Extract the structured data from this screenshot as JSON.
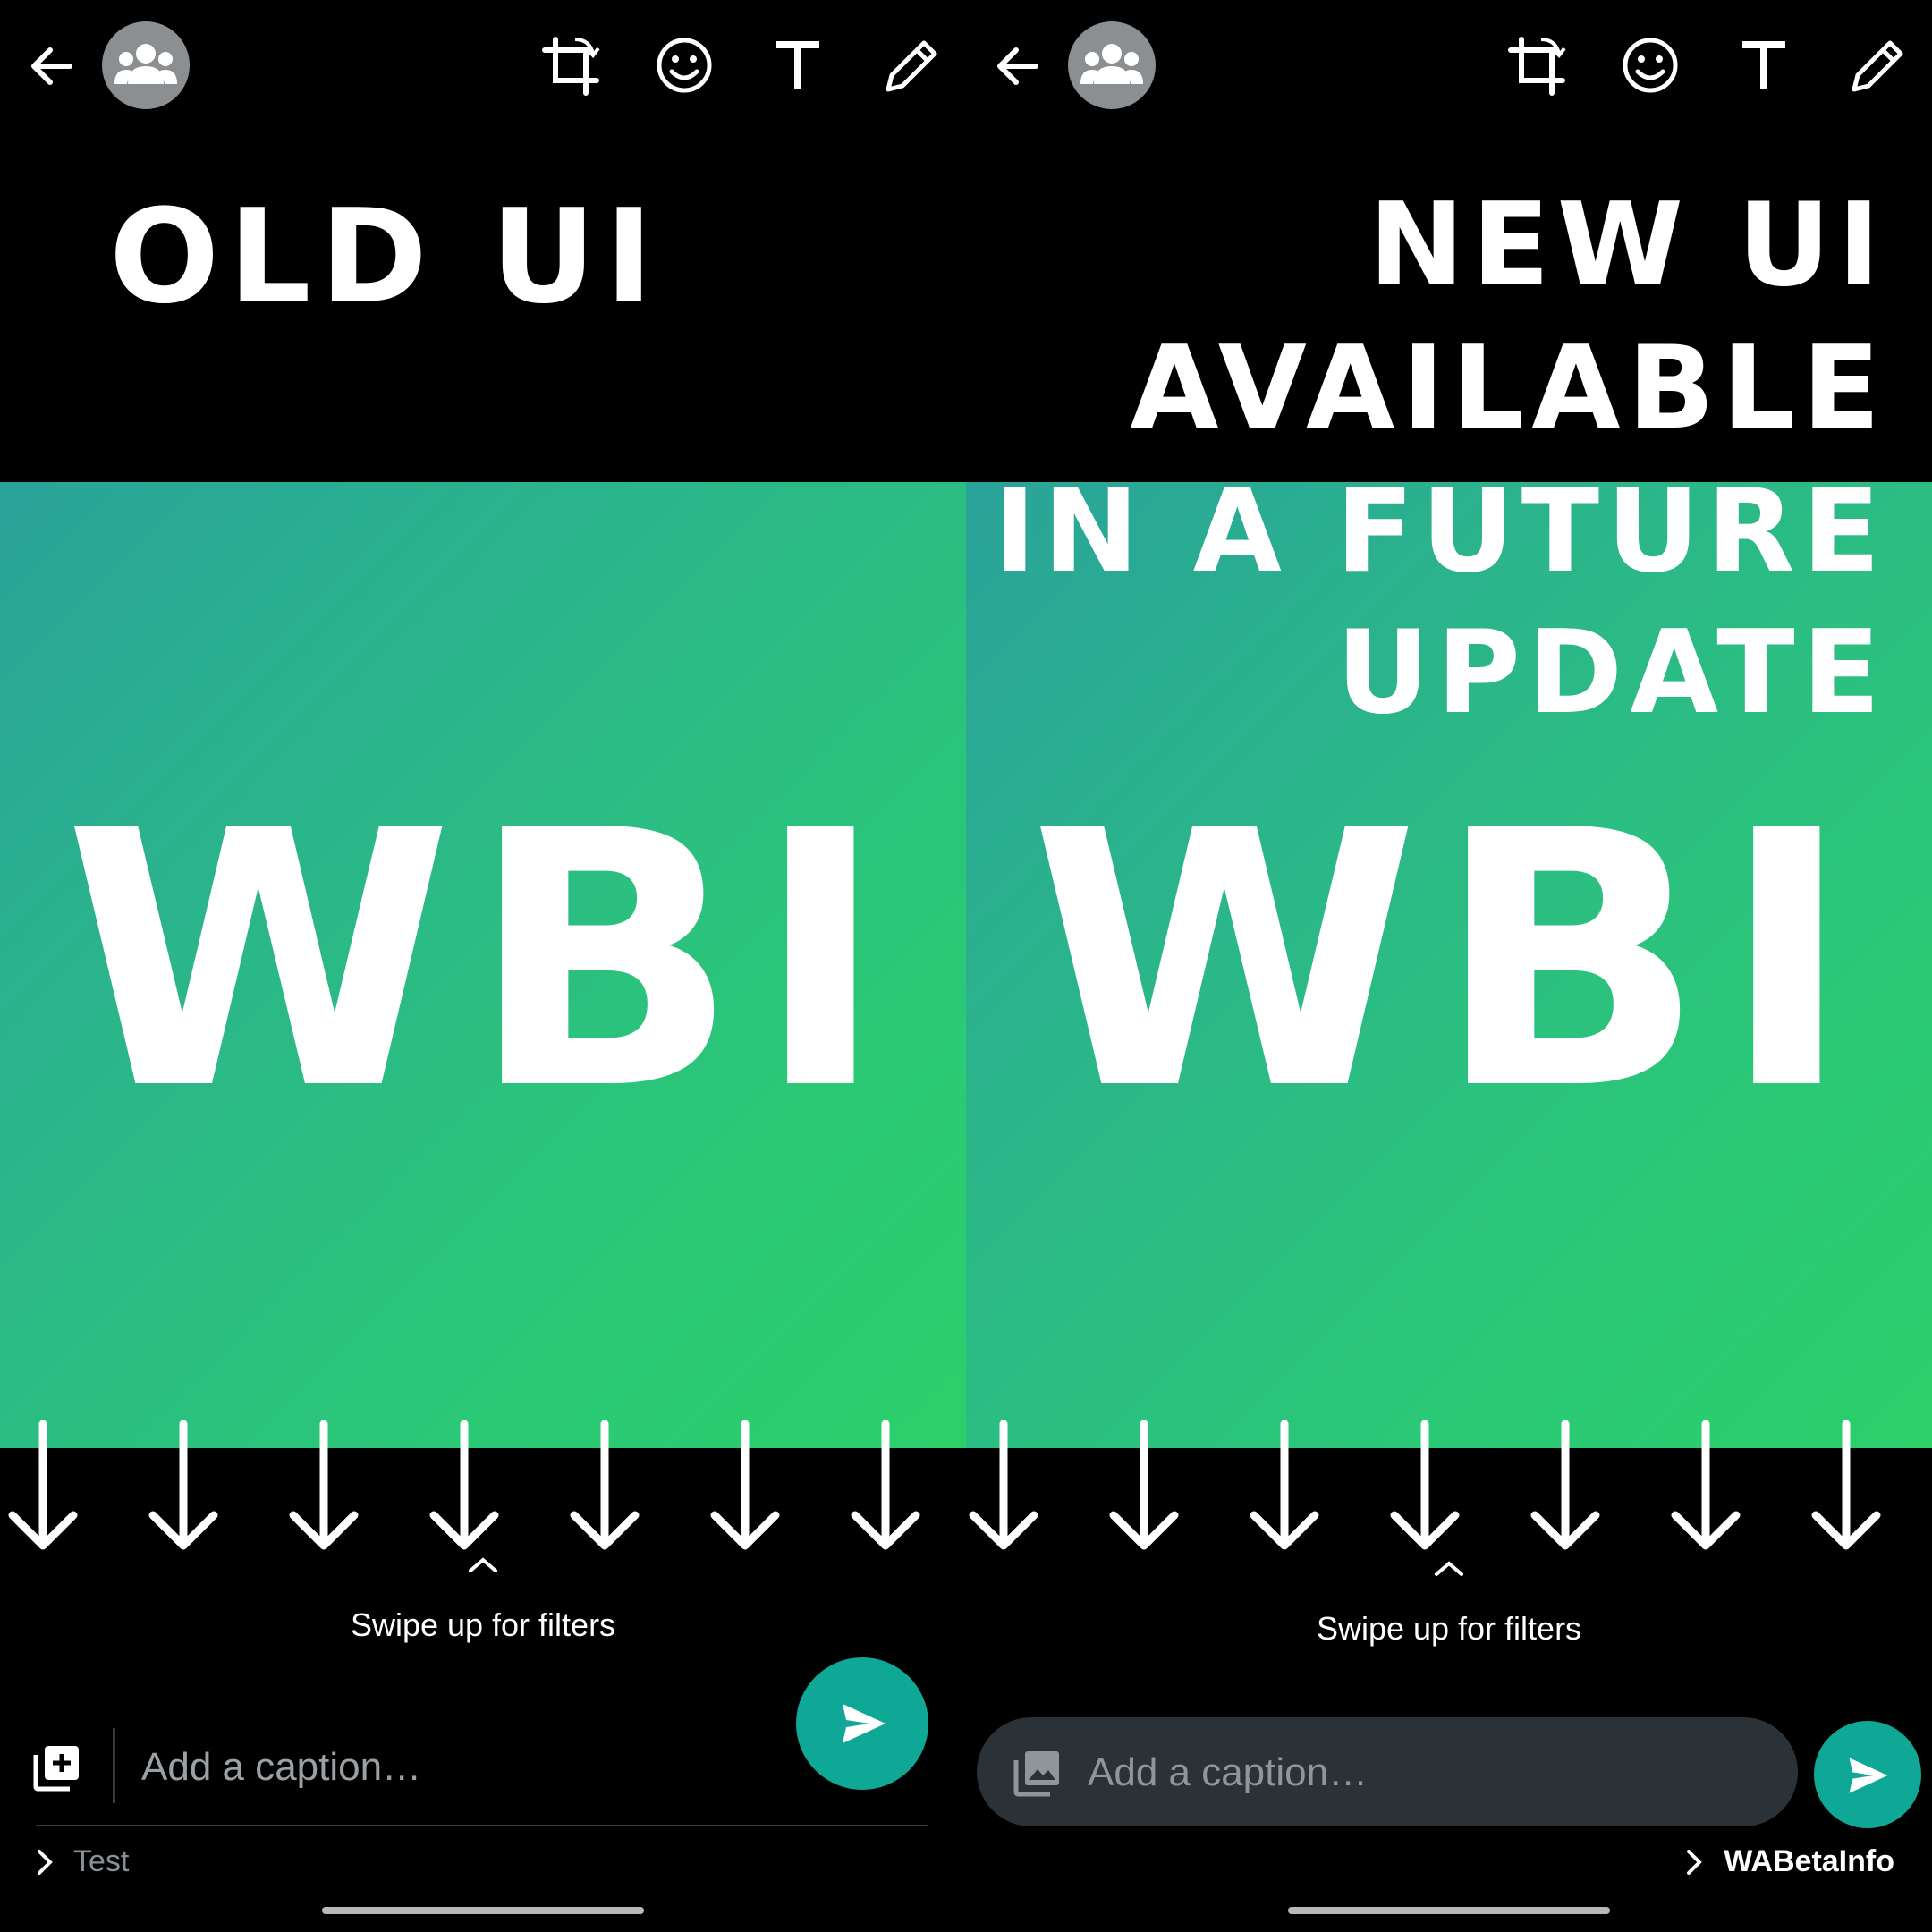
{
  "colors": {
    "background": "#000000",
    "image_gradient_start": "#2aa39a",
    "image_gradient_end": "#2bd06a",
    "send_button": "#0fa896",
    "new_caption_pill": "#2b3237",
    "avatar_bg": "#8b8f92"
  },
  "icons": {
    "back": "arrow-left-icon",
    "avatar": "group-icon",
    "crop": "crop-rotate-icon",
    "emoji": "emoji-icon",
    "text": "text-icon",
    "draw": "pencil-icon",
    "arrow": "arrow-down-icon",
    "swipe": "chevron-up-icon",
    "old_media": "add-media-icon",
    "new_media": "gallery-icon",
    "send": "send-icon",
    "recipient": "chevron-right-icon"
  },
  "old_panel": {
    "title": "OLD UI",
    "image_text": "WBI",
    "swipe_hint": "Swipe up for filters",
    "caption_placeholder": "Add a caption…",
    "recipient": "Test"
  },
  "new_panel": {
    "title_lines": [
      "NEW UI",
      "AVAILABLE",
      "IN A FUTURE",
      "UPDATE"
    ],
    "image_text": "WBI",
    "swipe_hint": "Swipe up for filters",
    "caption_placeholder": "Add a caption…",
    "recipient": "WABetaInfo"
  }
}
